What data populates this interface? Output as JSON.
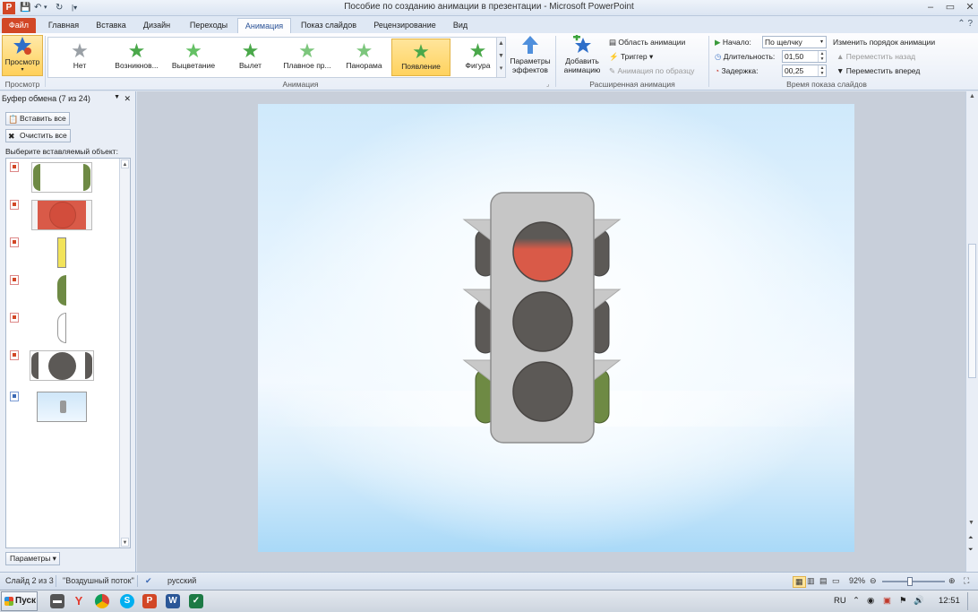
{
  "window": {
    "title": "Пособие по созданию анимации в презентации  -  Microsoft PowerPoint",
    "app_icon": "P"
  },
  "tabs": [
    "Файл",
    "Главная",
    "Вставка",
    "Дизайн",
    "Переходы",
    "Анимация",
    "Показ слайдов",
    "Рецензирование",
    "Вид"
  ],
  "active_tab": "Анимация",
  "ribbon": {
    "preview": {
      "label": "Просмотр",
      "group": "Просмотр"
    },
    "animations": [
      {
        "label": "Нет",
        "color": "#9aa0a6"
      },
      {
        "label": "Возникнов...",
        "color": "#4aa84a"
      },
      {
        "label": "Выцветание",
        "color": "#64c064"
      },
      {
        "label": "Вылет",
        "color": "#4aa84a"
      },
      {
        "label": "Плавное пр...",
        "color": "#7cc67c"
      },
      {
        "label": "Панорама",
        "color": "#7cc67c"
      },
      {
        "label": "Появление",
        "color": "#4aa84a",
        "selected": true
      },
      {
        "label": "Фигура",
        "color": "#4aa84a"
      }
    ],
    "effect_params": "Параметры эффектов",
    "animation_group": "Анимация",
    "add_animation": "Добавить анимацию",
    "animation_area": "Область анимации",
    "trigger": "Триггер",
    "anim_painter": "Анимация по образцу",
    "advanced_group": "Расширенная анимация",
    "start_label": "Начало:",
    "start_value": "По щелчку",
    "duration_label": "Длительность:",
    "duration_value": "01,50",
    "delay_label": "Задержка:",
    "delay_value": "00,25",
    "reorder_label": "Изменить порядок анимации",
    "move_back": "Переместить назад",
    "move_forward": "Переместить вперед",
    "timing_group": "Время показа слайдов"
  },
  "pane": {
    "title": "Буфер обмена (7 из 24)",
    "paste_all": "Вставить все",
    "clear_all": "Очистить все",
    "choose_label": "Выберите вставляемый объект:",
    "options": "Параметры"
  },
  "status": {
    "slide": "Слайд 2 из 3",
    "theme": "\"Воздушный поток\"",
    "language": "русский",
    "zoom": "92%"
  },
  "taskbar": {
    "start": "Пуск",
    "lang": "RU",
    "clock": "12:51"
  }
}
